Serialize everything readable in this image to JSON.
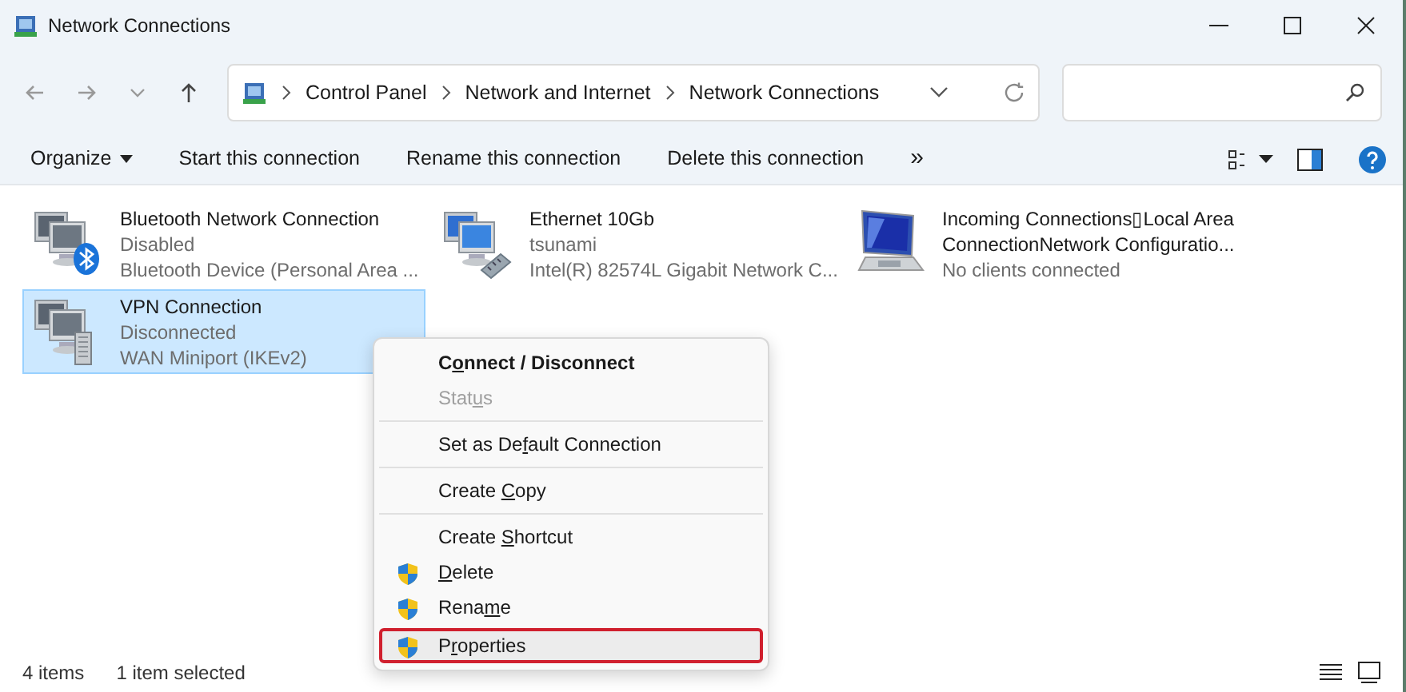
{
  "window": {
    "title": "Network Connections"
  },
  "address": {
    "crumbs": [
      "Control Panel",
      "Network and Internet",
      "Network Connections"
    ]
  },
  "toolbar": {
    "commands": [
      {
        "label": "Organize",
        "kind": "menu"
      },
      {
        "label": "Start this connection",
        "kind": "plain"
      },
      {
        "label": "Rename this connection",
        "kind": "plain"
      },
      {
        "label": "Delete this connection",
        "kind": "plain"
      },
      {
        "label": "»",
        "kind": "overflow"
      }
    ]
  },
  "connections": [
    {
      "name": "Bluetooth Network Connection",
      "status": "Disabled",
      "device": "Bluetooth Device (Personal Area ...",
      "kind": "bluetooth",
      "selected": false
    },
    {
      "name": "Ethernet 10Gb",
      "status": "tsunami",
      "device": "Intel(R) 82574L Gigabit Network C...",
      "kind": "ethernet",
      "selected": false
    },
    {
      "name": "Incoming Connections▯Local Area ConnectionNetwork Configuratio...",
      "status": "No clients connected",
      "kind": "incoming",
      "selected": false
    },
    {
      "name": "VPN Connection",
      "status": "Disconnected",
      "device": "WAN Miniport (IKEv2)",
      "kind": "vpn",
      "selected": true
    }
  ],
  "context_menu": {
    "items": [
      {
        "kind": "item",
        "parts": [
          {
            "text": "C",
            "underline": false
          },
          {
            "text": "o",
            "underline": true
          },
          {
            "text": "nnect / Disconnect",
            "underline": false
          }
        ],
        "default": true,
        "disabled": false,
        "shield": false,
        "highlighted": false
      },
      {
        "kind": "item",
        "parts": [
          {
            "text": "Stat",
            "underline": false
          },
          {
            "text": "u",
            "underline": true
          },
          {
            "text": "s",
            "underline": false
          }
        ],
        "default": false,
        "disabled": true,
        "shield": false,
        "highlighted": false
      },
      {
        "kind": "separator"
      },
      {
        "kind": "item",
        "parts": [
          {
            "text": "Set as De",
            "underline": false
          },
          {
            "text": "f",
            "underline": true
          },
          {
            "text": "ault Connection",
            "underline": false
          }
        ],
        "default": false,
        "disabled": false,
        "shield": false,
        "highlighted": false
      },
      {
        "kind": "separator"
      },
      {
        "kind": "item",
        "parts": [
          {
            "text": "Create ",
            "underline": false
          },
          {
            "text": "C",
            "underline": true
          },
          {
            "text": "opy",
            "underline": false
          }
        ],
        "default": false,
        "disabled": false,
        "shield": false,
        "highlighted": false
      },
      {
        "kind": "separator"
      },
      {
        "kind": "item",
        "parts": [
          {
            "text": "Create ",
            "underline": false
          },
          {
            "text": "S",
            "underline": true
          },
          {
            "text": "hortcut",
            "underline": false
          }
        ],
        "default": false,
        "disabled": false,
        "shield": false,
        "highlighted": false
      },
      {
        "kind": "item",
        "parts": [
          {
            "text": "D",
            "underline": true
          },
          {
            "text": "elete",
            "underline": false
          }
        ],
        "default": false,
        "disabled": false,
        "shield": true,
        "highlighted": false
      },
      {
        "kind": "item",
        "parts": [
          {
            "text": "Rena",
            "underline": false
          },
          {
            "text": "m",
            "underline": true
          },
          {
            "text": "e",
            "underline": false
          }
        ],
        "default": false,
        "disabled": false,
        "shield": true,
        "highlighted": false
      },
      {
        "kind": "item",
        "parts": [
          {
            "text": "P",
            "underline": false
          },
          {
            "text": "r",
            "underline": true
          },
          {
            "text": "operties",
            "underline": false
          }
        ],
        "default": false,
        "disabled": false,
        "shield": true,
        "highlighted": true
      }
    ]
  },
  "status_bar": {
    "item_count": "4 items",
    "selection": "1 item selected"
  }
}
